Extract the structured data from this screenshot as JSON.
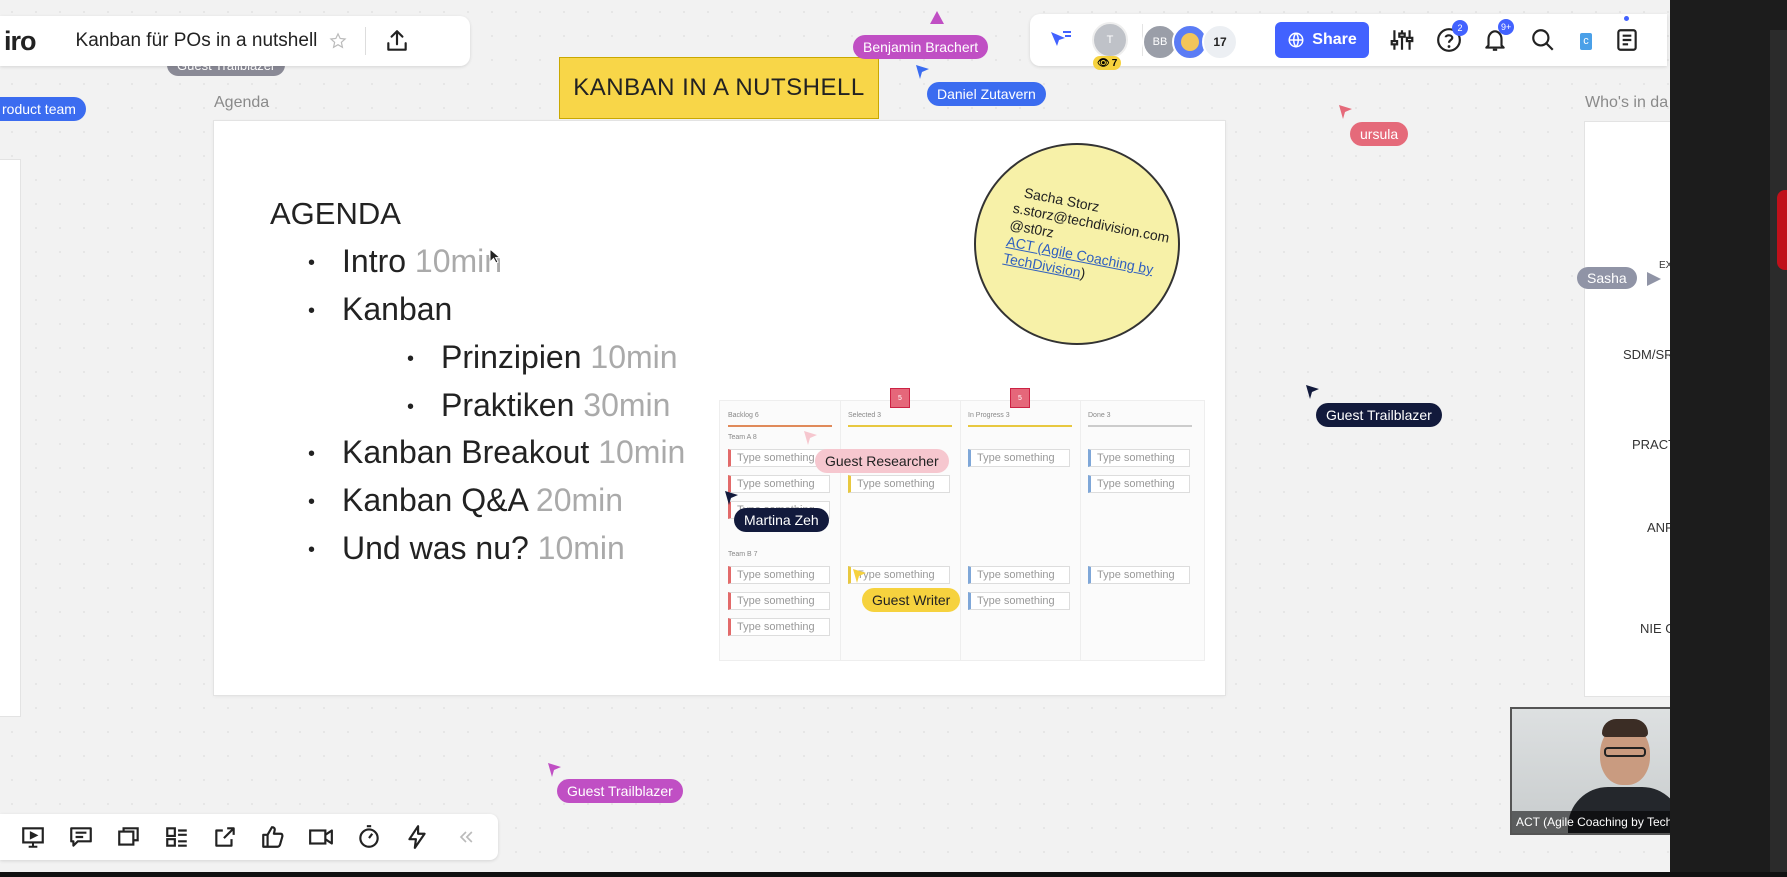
{
  "app": {
    "logo_text": "iro"
  },
  "header": {
    "board_title": "Kanban für POs in a nutshell",
    "behind_toolbar_label": "Guest Trailblazer"
  },
  "toolbar_right": {
    "share_label": "Share",
    "help_badge": "2",
    "notifications_badge": "9+",
    "avatar_t": "T",
    "avatar_bb": "BB",
    "viewers_count": "7",
    "collaborators_count": "17",
    "hidden_button_text": "c"
  },
  "frames": {
    "left_label": "roduct team",
    "agenda_label": "Agenda",
    "right_label": "Who's in da"
  },
  "title_sticky": "KANBAN IN A NUTSHELL",
  "agenda": {
    "title": "AGENDA",
    "items": [
      {
        "label": "Intro",
        "duration": "10min"
      },
      {
        "label": "Kanban",
        "duration": ""
      },
      {
        "label": "Prinzipien",
        "duration": "10min"
      },
      {
        "label": "Praktiken",
        "duration": "30min"
      },
      {
        "label": "Kanban Breakout",
        "duration": "10min"
      },
      {
        "label": "Kanban Q&A",
        "duration": "20min"
      },
      {
        "label": "Und was nu?",
        "duration": "10min"
      }
    ]
  },
  "contact": {
    "name": "Sacha Storz",
    "email": "s.storz@techdivision.com",
    "handle": "@st0rz",
    "company_link": "ACT (Agile Coaching by TechDivision",
    "company_close": ")"
  },
  "kanban_board": {
    "columns": [
      "Backlog 6",
      "Selected 3",
      "In Progress 3",
      "Done 3"
    ],
    "rows": [
      "Team A 8",
      "Team B 7"
    ],
    "card_placeholder": "Type something",
    "pins": [
      "5",
      "5"
    ]
  },
  "cursors": {
    "benjamin": "Benjamin Brachert",
    "daniel": "Daniel Zutavern",
    "ursula": "ursula",
    "sasha": "Sasha",
    "guest_trailblazer_right": "Guest Trailblazer",
    "guest_researcher": "Guest Researcher",
    "martina": "Martina Zeh",
    "guest_writer": "Guest Writer",
    "guest_trailblazer_bottom": "Guest Trailblazer"
  },
  "right_frame_items": [
    "EX",
    "SDM/SR",
    "PRACT",
    "ANF",
    "NIE G"
  ],
  "video": {
    "caption": "ACT (Agile Coaching by TechDiv..."
  },
  "colors": {
    "accent": "#4262ff",
    "sticky_yellow": "#f8d648",
    "cursor_purple": "#c04fc4",
    "cursor_blue": "#3b6cf0",
    "cursor_red": "#e56a7a",
    "cursor_dark": "#121a3c",
    "cursor_yellow": "#f6d23e",
    "cursor_pink": "#f6c7cf",
    "cursor_gray": "#9094a6"
  }
}
